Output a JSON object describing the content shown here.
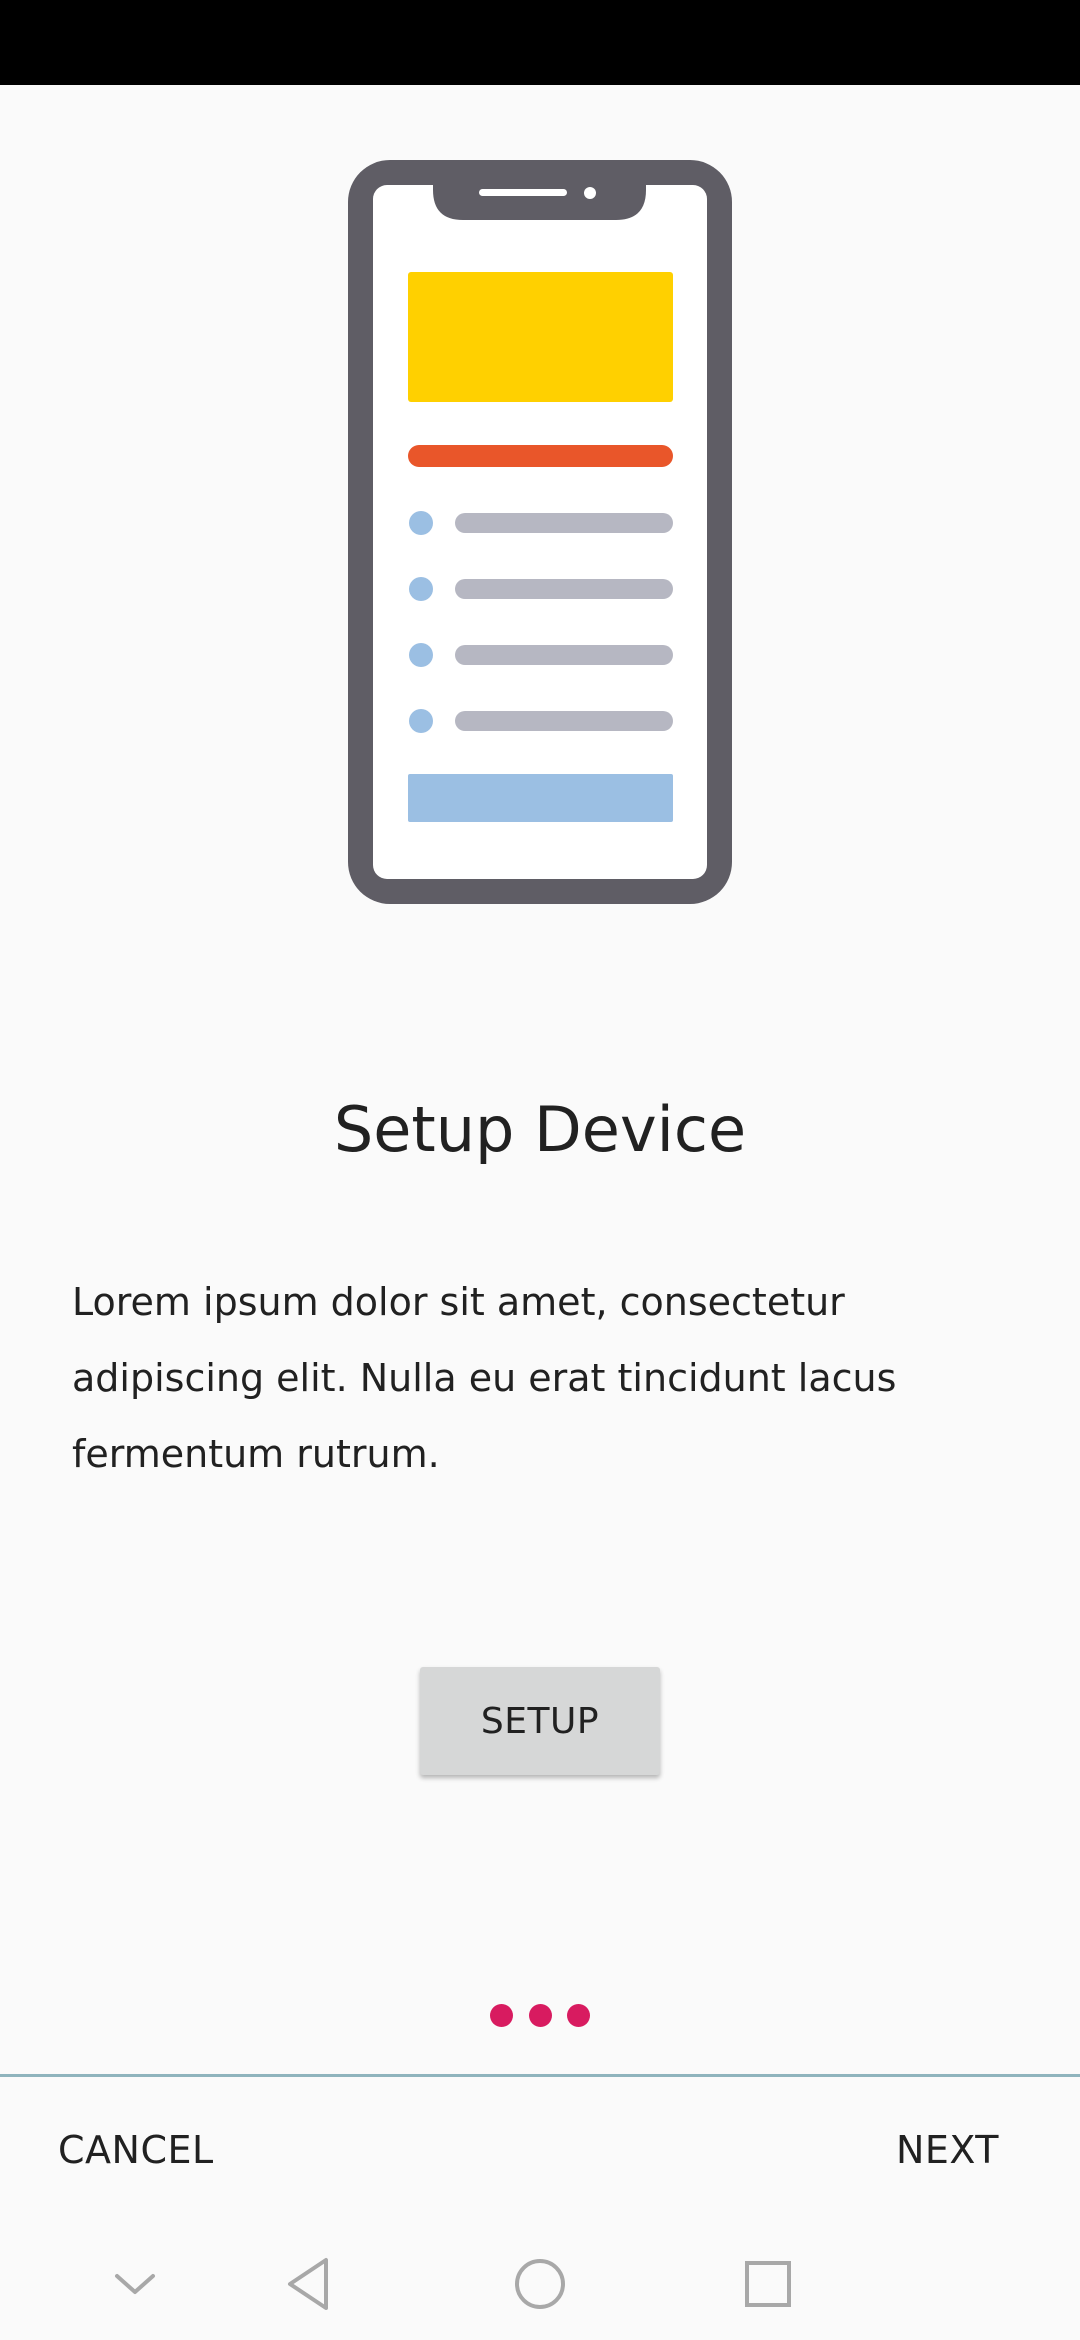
{
  "colors": {
    "background": "#fafafa",
    "status_bar": "#000000",
    "phone_frame": "#5f5d65",
    "phone_screen": "#ffffff",
    "header_block": "#ffd000",
    "accent_line": "#e9562a",
    "list_bullet": "#9bbfe3",
    "list_line": "#b6b7c2",
    "bottom_block": "#9bbfe3",
    "page_dot": "#d81b60",
    "divider": "#8fb4bd",
    "button_bg": "#d6d7d7",
    "nav_icon": "#a8a8a8"
  },
  "main": {
    "title": "Setup Device",
    "description": "Lorem ipsum dolor sit amet, consectetur adipiscing elit. Nulla eu erat tincidunt lacus fermentum rutrum.",
    "setup_button_label": "SETUP"
  },
  "page_indicator": {
    "total": 3
  },
  "footer": {
    "cancel_label": "CANCEL",
    "next_label": "NEXT"
  },
  "nav_bar": {
    "icons": [
      "chevron-down-icon",
      "back-triangle-icon",
      "home-circle-icon",
      "recents-square-icon"
    ]
  }
}
